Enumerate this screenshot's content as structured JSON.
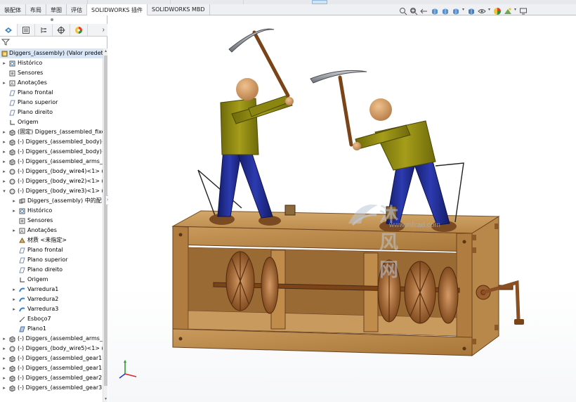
{
  "tabs": [
    {
      "label": "装配体",
      "active": false
    },
    {
      "label": "布局",
      "active": false
    },
    {
      "label": "草图",
      "active": false
    },
    {
      "label": "评估",
      "active": false
    },
    {
      "label": "SOLIDWORKS 插件",
      "active": true
    },
    {
      "label": "SOLIDWORKS MBD",
      "active": false
    }
  ],
  "panel": {
    "tabs": [
      "feature-manager",
      "property-manager",
      "configuration-manager",
      "dimxpert",
      "display-manager"
    ],
    "chevron": "›",
    "filter_icon": "funnel-icon"
  },
  "tree": [
    {
      "label": "Diggers_(assembly)  (Valor predete",
      "indent": 0,
      "expand": "",
      "icon": "assembly",
      "selected": true
    },
    {
      "label": "Histórico",
      "indent": 1,
      "expand": "▸",
      "icon": "history"
    },
    {
      "label": "Sensores",
      "indent": 1,
      "expand": "",
      "icon": "sensor"
    },
    {
      "label": "Anotações",
      "indent": 1,
      "expand": "▸",
      "icon": "annotation"
    },
    {
      "label": "Plano frontal",
      "indent": 1,
      "expand": "",
      "icon": "plane"
    },
    {
      "label": "Plano superior",
      "indent": 1,
      "expand": "",
      "icon": "plane"
    },
    {
      "label": "Plano direito",
      "indent": 1,
      "expand": "",
      "icon": "plane"
    },
    {
      "label": "Origem",
      "indent": 1,
      "expand": "",
      "icon": "origin"
    },
    {
      "label": "(固定) Diggers_(assembled_fixe",
      "indent": 1,
      "expand": "▸",
      "icon": "part"
    },
    {
      "label": "(-) Diggers_(assembled_body)<",
      "indent": 1,
      "expand": "▸",
      "icon": "part"
    },
    {
      "label": "(-) Diggers_(assembled_body)<",
      "indent": 1,
      "expand": "▸",
      "icon": "part"
    },
    {
      "label": "(-) Diggers_(assembled_arms_p",
      "indent": 1,
      "expand": "▸",
      "icon": "part"
    },
    {
      "label": "(-) Diggers_(body_wire4)<1> (V",
      "indent": 1,
      "expand": "▸",
      "icon": "gear-part"
    },
    {
      "label": "(-) Diggers_(body_wire2)<1> (V",
      "indent": 1,
      "expand": "▸",
      "icon": "gear-part"
    },
    {
      "label": "(-) Diggers_(body_wire3)<1> (V",
      "indent": 1,
      "expand": "▾",
      "icon": "gear-part"
    },
    {
      "label": "Diggers_(assembly) 中的配",
      "indent": 2,
      "expand": "▸",
      "icon": "mates"
    },
    {
      "label": "Histórico",
      "indent": 2,
      "expand": "▸",
      "icon": "history"
    },
    {
      "label": "Sensores",
      "indent": 2,
      "expand": "",
      "icon": "sensor"
    },
    {
      "label": "Anotações",
      "indent": 2,
      "expand": "▸",
      "icon": "annotation"
    },
    {
      "label": "材质 <未指定>",
      "indent": 2,
      "expand": "",
      "icon": "material"
    },
    {
      "label": "Plano frontal",
      "indent": 2,
      "expand": "",
      "icon": "plane"
    },
    {
      "label": "Plano superior",
      "indent": 2,
      "expand": "",
      "icon": "plane"
    },
    {
      "label": "Plano direito",
      "indent": 2,
      "expand": "",
      "icon": "plane"
    },
    {
      "label": "Origem",
      "indent": 2,
      "expand": "",
      "icon": "origin"
    },
    {
      "label": "Varredura1",
      "indent": 2,
      "expand": "▸",
      "icon": "sweep"
    },
    {
      "label": "Varredura2",
      "indent": 2,
      "expand": "▸",
      "icon": "sweep"
    },
    {
      "label": "Varredura3",
      "indent": 2,
      "expand": "▸",
      "icon": "sweep"
    },
    {
      "label": "Esboço7",
      "indent": 2,
      "expand": "",
      "icon": "sketch"
    },
    {
      "label": "Plano1",
      "indent": 2,
      "expand": "",
      "icon": "plane-solid"
    },
    {
      "label": "(-) Diggers_(assembled_arms_p",
      "indent": 1,
      "expand": "▸",
      "icon": "part"
    },
    {
      "label": "(-) Diggers_(body_wire5)<1> (V",
      "indent": 1,
      "expand": "▸",
      "icon": "gear-part"
    },
    {
      "label": "(-) Diggers_(assembled_gear1)-",
      "indent": 1,
      "expand": "▸",
      "icon": "part"
    },
    {
      "label": "(-) Diggers_(assembled_gear1)-",
      "indent": 1,
      "expand": "▸",
      "icon": "part"
    },
    {
      "label": "(-) Diggers_(assembled_gear2)-",
      "indent": 1,
      "expand": "▸",
      "icon": "part"
    },
    {
      "label": "(-) Diggers_(assembled_gear3)-",
      "indent": 1,
      "expand": "▸",
      "icon": "part"
    }
  ],
  "hud_icons": [
    "zoom-to-fit-icon",
    "zoom-area-icon",
    "previous-view-icon",
    "section-view-icon",
    "dynamic-annotation-icon",
    "view-orientation-icon",
    "display-style-icon",
    "hide-show-icon",
    "edit-appearance-icon",
    "apply-scene-icon",
    "view-settings-icon"
  ],
  "watermark": {
    "cn": "沐风网",
    "en": "www.mfcad.com"
  },
  "colors": {
    "wood": "#b98a4c",
    "wood_dark": "#6a4220",
    "shirt": "#8f8a12",
    "pants": "#1e2a8c",
    "boots": "#7a4a22",
    "pick": "#8a8d92",
    "skin": "#d7a06c"
  }
}
